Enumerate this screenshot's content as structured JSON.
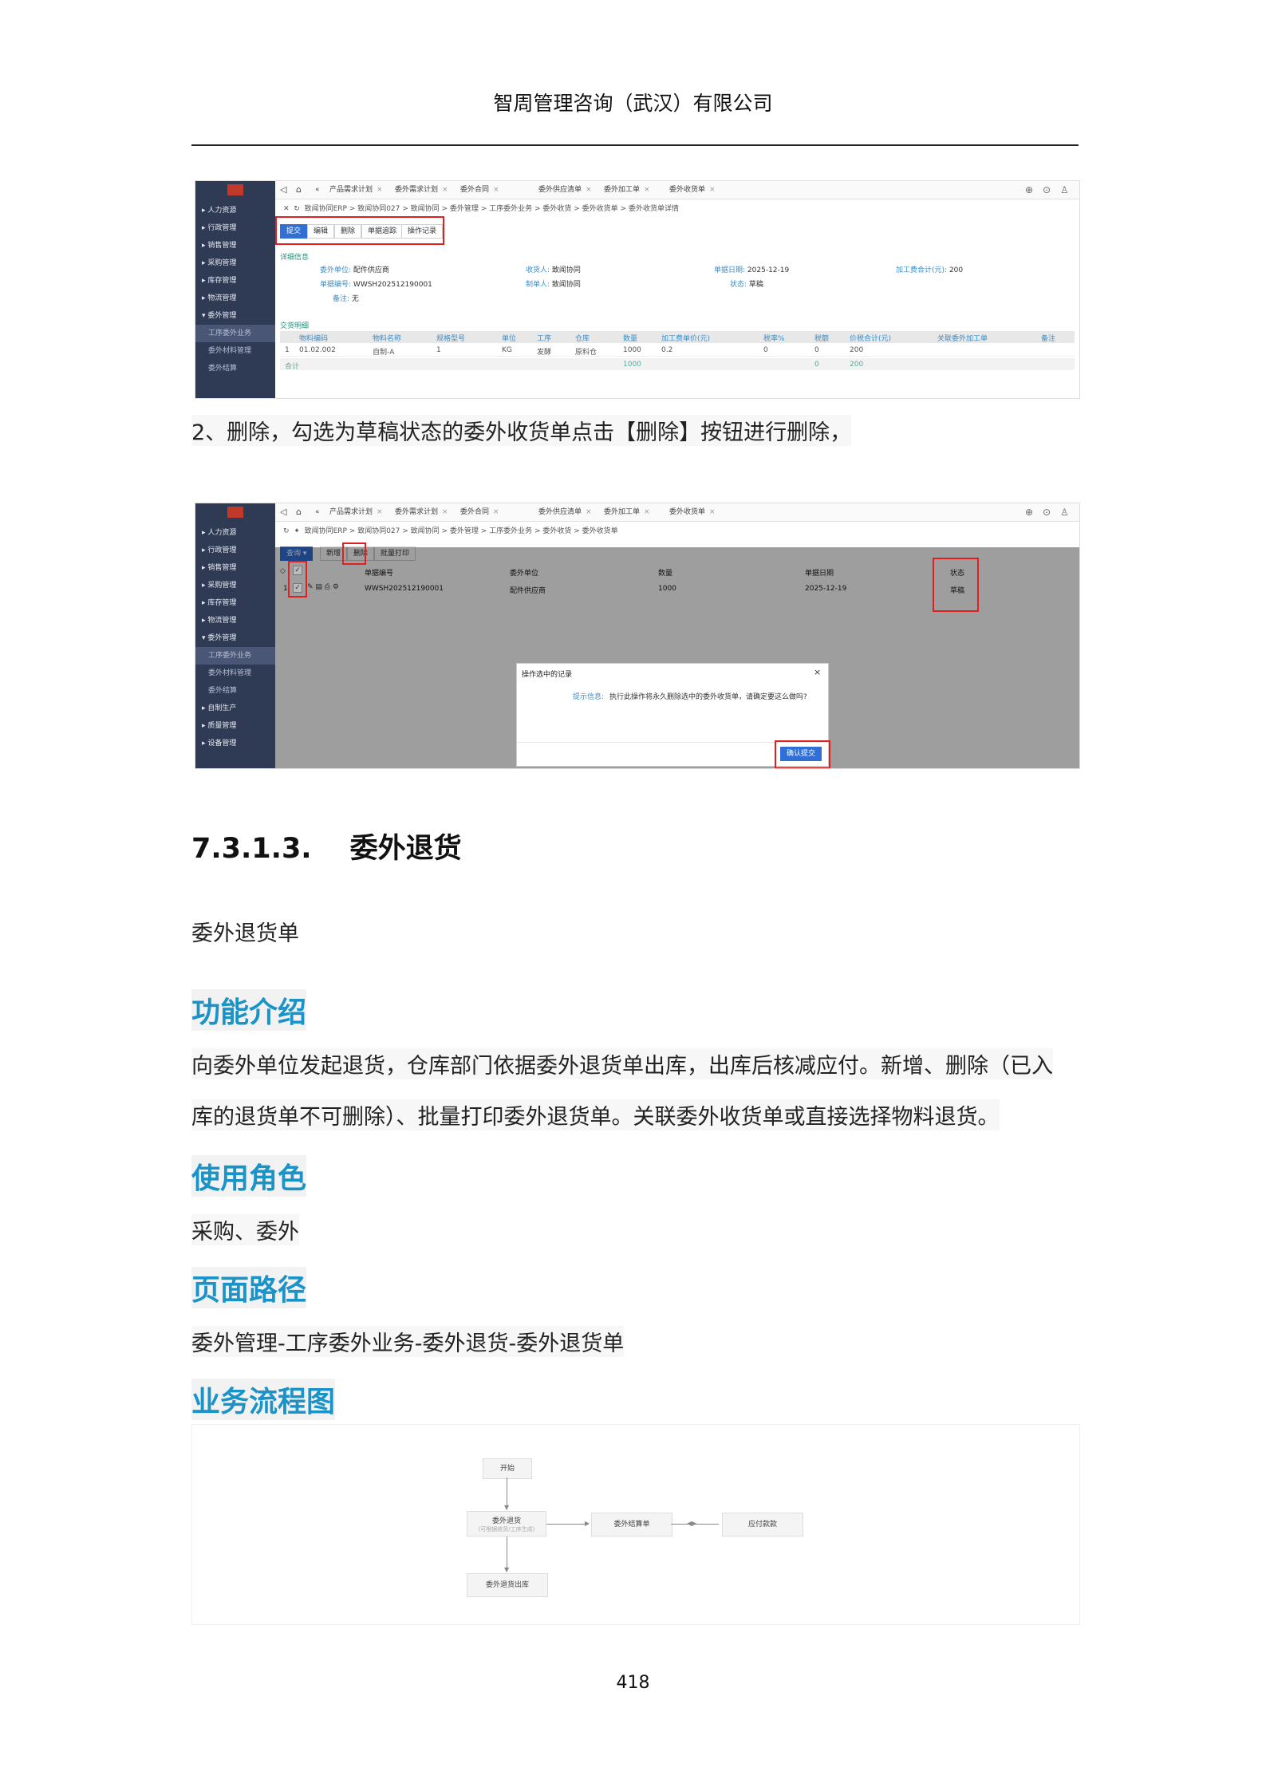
{
  "header": {
    "title": "智周管理咨询（武汉）有限公司"
  },
  "ui1": {
    "sidebar": [
      "▸ 人力资源",
      "▸ 行政管理",
      "▸ 销售管理",
      "▸ 采购管理",
      "▸ 库存管理",
      "▸ 物流管理",
      "▾ 委外管理",
      "工序委外业务",
      "委外材料管理",
      "委外结算"
    ],
    "tabs": [
      "产品需求计划",
      "委外需求计划",
      "委外合同",
      "委外供应清单",
      "委外加工单",
      "委外收货单"
    ],
    "breadcrumb": "致闻协同ERP > 致闻协同027 > 致闻协同 > 委外管理 > 工序委外业务 > 委外收货 > 委外收货单 > 委外收货单详情",
    "buttons": [
      "提交",
      "编辑",
      "删除",
      "单据追踪",
      "操作记录"
    ],
    "detail_section": "详细信息",
    "fields": {
      "supplier_k": "委外单位:",
      "supplier_v": "配件供应商",
      "receiver_k": "收货人:",
      "receiver_v": "致闻协同",
      "docdate_k": "单据日期:",
      "docdate_v": "2025-12-19",
      "total_k": "加工费合计(元):",
      "total_v": "200",
      "docno_k": "单据编号:",
      "docno_v": "WWSH202512190001",
      "maker_k": "制单人:",
      "maker_v": "致闻协同",
      "status_k": "状态:",
      "status_v": "草稿",
      "note_k": "备注:",
      "note_v": "无"
    },
    "detail2_section": "交货明细",
    "table_headers": [
      "物料编码",
      "物料名称",
      "规格型号",
      "单位",
      "工序",
      "仓库",
      "数量",
      "加工费单价(元)",
      "税率%",
      "税额",
      "价税合计(元)",
      "关联委外加工单",
      "备注"
    ],
    "row": [
      "1",
      "01.02.002",
      "自制-A",
      "1",
      "KG",
      "发酵",
      "原料仓",
      "1000",
      "0.2",
      "0",
      "0",
      "200"
    ],
    "total_row": [
      "合计",
      "1000",
      "0",
      "200"
    ]
  },
  "caption2": "2、删除，勾选为草稿状态的委外收货单点击【删除】按钮进行删除，",
  "ui2": {
    "sidebar": [
      "▸ 人力资源",
      "▸ 行政管理",
      "▸ 销售管理",
      "▸ 采购管理",
      "▸ 库存管理",
      "▸ 物流管理",
      "▾ 委外管理",
      "工序委外业务",
      "委外材料管理",
      "委外结算",
      "▸ 自制生产",
      "▸ 质量管理",
      "▸ 设备管理"
    ],
    "tabs": [
      "产品需求计划",
      "委外需求计划",
      "委外合同",
      "委外供应清单",
      "委外加工单",
      "委外收货单"
    ],
    "breadcrumb": "致闻协同ERP > 致闻协同027 > 致闻协同 > 委外管理 > 工序委外业务 > 委外收货 > 委外收货单",
    "buttons": [
      "查询",
      "新增",
      "删除",
      "批量打印"
    ],
    "headers": [
      "单据编号",
      "委外单位",
      "数量",
      "单据日期",
      "状态"
    ],
    "row": [
      "1",
      "WWSH202512190001",
      "配件供应商",
      "1000",
      "2025-12-19",
      "草稿"
    ],
    "dialog": {
      "title": "操作选中的记录",
      "label": "提示信息:",
      "message": "执行此操作将永久删除选中的委外收货单，请确定要这么做吗?",
      "confirm": "确认提交"
    }
  },
  "section": {
    "number": "7.3.1.3.",
    "title": "委外退货"
  },
  "subtitle": "委外退货单",
  "intro": {
    "heading": "功能介绍",
    "line1": "向委外单位发起退货，仓库部门依据委外退货单出库，出库后核减应付。新增、删除（已入",
    "line2": "库的退货单不可删除）、批量打印委外退货单。关联委外收货单或直接选择物料退货。"
  },
  "roles": {
    "heading": "使用角色",
    "text": "采购、委外"
  },
  "path": {
    "heading": "页面路径",
    "text": "委外管理-工序委外业务-委外退货-委外退货单"
  },
  "flow": {
    "heading": "业务流程图",
    "start": "开始",
    "return": "委外退货",
    "return_sub": "(可根据收货/工序生成)",
    "settle": "委外结算单",
    "payable": "应付款款",
    "outbound": "委外退货出库"
  },
  "page_number": "418"
}
